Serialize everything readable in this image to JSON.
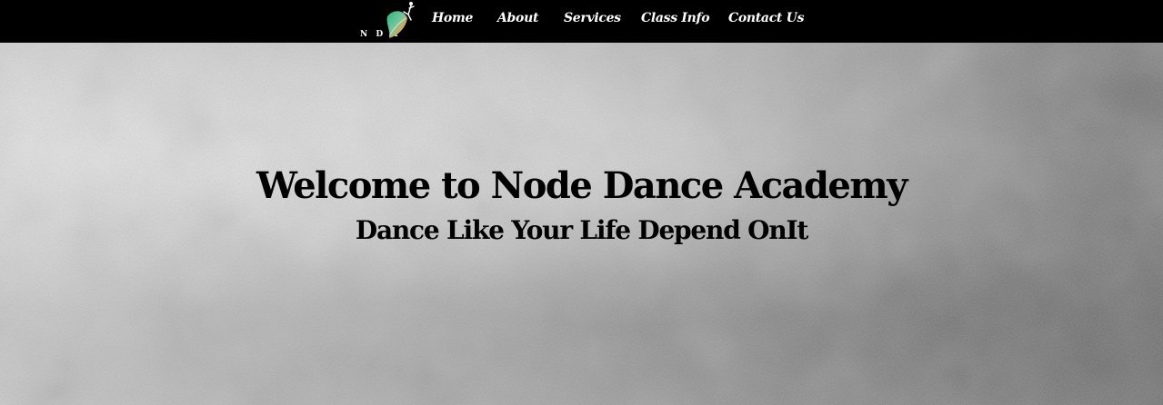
{
  "nav": {
    "logo_text": "N D A",
    "logo_icon": "dancer-leaf-icon",
    "links": [
      {
        "label": "Home"
      },
      {
        "label": "About"
      },
      {
        "label": "Services"
      },
      {
        "label": "Class Info"
      },
      {
        "label": "Contact Us"
      }
    ]
  },
  "hero": {
    "title": "Welcome to Node Dance Academy",
    "subtitle": "Dance Like Your Life Depend OnIt"
  },
  "colors": {
    "nav_background": "#000000",
    "nav_text": "#ffffff",
    "hero_text": "#000000"
  }
}
